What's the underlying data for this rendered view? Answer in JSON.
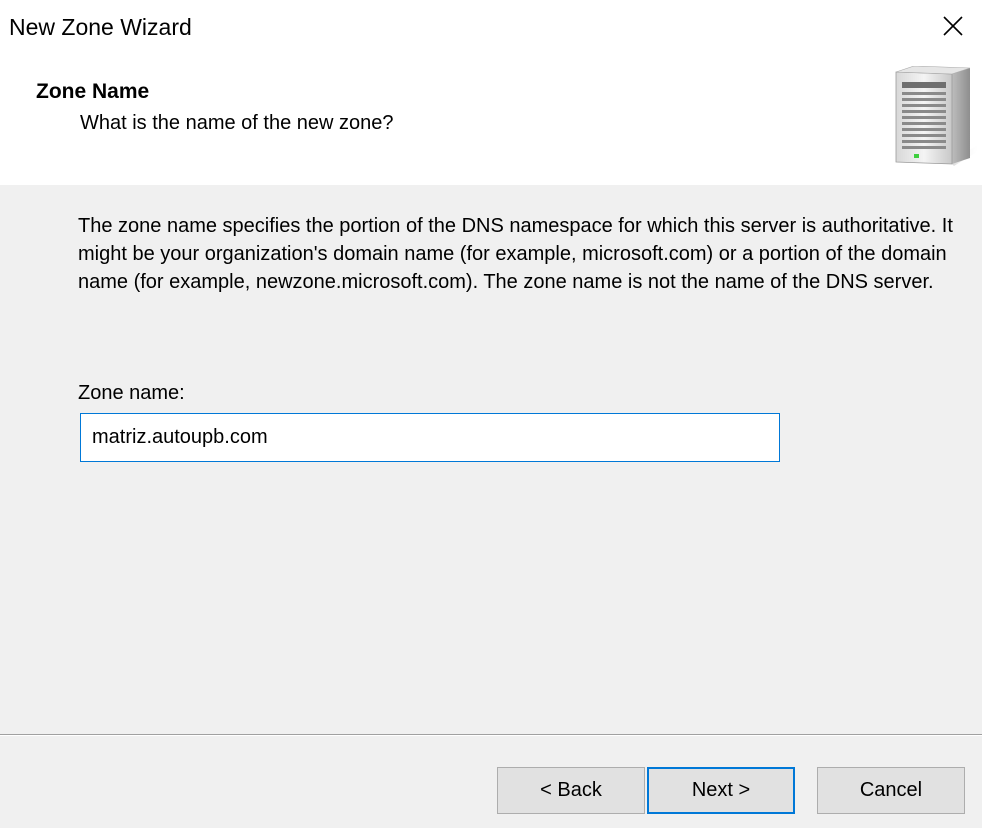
{
  "window": {
    "title": "New Zone Wizard",
    "close_icon": "close-icon"
  },
  "header": {
    "title": "Zone Name",
    "subtitle": "What is the name of the new zone?",
    "icon": "server-icon"
  },
  "body": {
    "description": "The zone name specifies the portion of the DNS namespace for which this server is authoritative. It might be your organization's domain name (for example,  microsoft.com) or a portion of the domain name (for example, newzone.microsoft.com). The zone name is not the name of the DNS server.",
    "zone_name_label": "Zone name:",
    "zone_name_value": "matriz.autoupb.com"
  },
  "buttons": {
    "back": "< Back",
    "next": "Next >",
    "cancel": "Cancel"
  },
  "colors": {
    "accent": "#0078d7",
    "background": "#f0f0f0",
    "header_background": "#ffffff"
  }
}
